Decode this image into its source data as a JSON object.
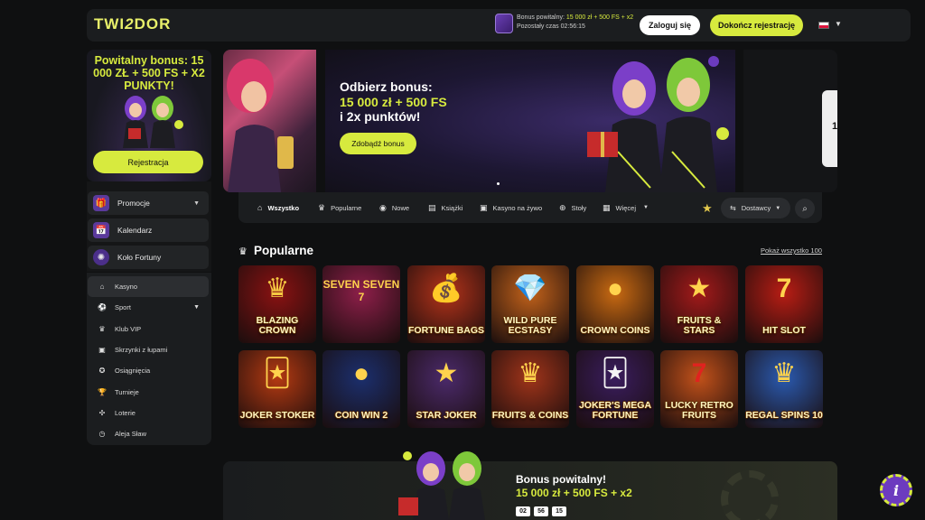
{
  "header": {
    "logo_left": "TWI",
    "logo_mid": "2",
    "logo_right": "DOR",
    "promo_line1_prefix": "Bonus powitalny: ",
    "promo_line1_highlight": "15 000 zł + 500 FS + x2",
    "promo_line2": "Pozostały czas 02:56:15",
    "login_label": "Zaloguj się",
    "register_label": "Dokończ rejestrację",
    "language_flag": "PL"
  },
  "sidebar": {
    "promo_title": "Powitalny bonus: 15 000 ZŁ + 500 FS + X2 PUNKTY!",
    "promo_button": "Rejestracja",
    "cards": [
      {
        "label": "Promocje",
        "icon": "gift-icon",
        "has_chevron": true
      },
      {
        "label": "Kalendarz",
        "icon": "calendar-icon",
        "has_chevron": false
      },
      {
        "label": "Koło Fortuny",
        "icon": "wheel-icon",
        "has_chevron": false
      }
    ],
    "menu": [
      {
        "label": "Kasyno",
        "icon": "home-icon",
        "active": true
      },
      {
        "label": "Sport",
        "icon": "sport-icon",
        "chevron": true
      },
      {
        "label": "Klub VIP",
        "icon": "vip-icon"
      },
      {
        "label": "Skrzynki z łupami",
        "icon": "box-icon"
      },
      {
        "label": "Osiągnięcia",
        "icon": "medal-icon"
      },
      {
        "label": "Turnieje",
        "icon": "trophy-icon"
      },
      {
        "label": "Loterie",
        "icon": "lottery-icon"
      },
      {
        "label": "Aleja Sław",
        "icon": "history-icon"
      }
    ]
  },
  "hero": {
    "title_line1": "Odbierz bonus:",
    "title_line2": "15 000 zł + 500 FS",
    "title_line3": "i 2x punktów!",
    "button": "Zdobądź bonus",
    "right_peek_number": "1"
  },
  "tabs": [
    {
      "label": "Wszystko",
      "icon": "home-icon",
      "active": true
    },
    {
      "label": "Popularne",
      "icon": "crown-icon"
    },
    {
      "label": "Nowe",
      "icon": "new-icon"
    },
    {
      "label": "Książki",
      "icon": "book-icon"
    },
    {
      "label": "Kasyno na żywo",
      "icon": "live-icon"
    },
    {
      "label": "Stoły",
      "icon": "table-icon"
    },
    {
      "label": "Więcej",
      "icon": "more-icon",
      "chevron": true
    }
  ],
  "providers_label": "Dostawcy",
  "section": {
    "title": "Popularne",
    "show_all": "Pokaż wszystko 100"
  },
  "games": [
    {
      "title": "BLAZING CROWN",
      "bg": "#8a1212",
      "sym": "♛",
      "symColor": "#f5c842"
    },
    {
      "title": "",
      "bg": "#8e1f4a",
      "sym": "SEVEN SEVEN 7",
      "symColor": "#ffd34d"
    },
    {
      "title": "FORTUNE BAGS",
      "bg": "#b4331a",
      "sym": "💰",
      "symColor": "#f5c842"
    },
    {
      "title": "WILD PURE ECSTASY",
      "bg": "#c2621a",
      "sym": "💎",
      "symColor": "#7fd9ff"
    },
    {
      "title": "CROWN COINS",
      "bg": "#c96a12",
      "sym": "●",
      "symColor": "#ffd34d"
    },
    {
      "title": "FRUITS & STARS",
      "bg": "#a31a1a",
      "sym": "★",
      "symColor": "#ffd34d"
    },
    {
      "title": "HIT SLOT",
      "bg": "#b81d14",
      "sym": "7",
      "symColor": "#ffd34d"
    },
    {
      "title": "JOKER STOKER",
      "bg": "#b53a12",
      "sym": "🃏",
      "symColor": "#ffd34d"
    },
    {
      "title": "COIN WIN 2",
      "bg": "#1b2f6e",
      "sym": "●",
      "symColor": "#ffd34d"
    },
    {
      "title": "STAR JOKER",
      "bg": "#4b2a6b",
      "sym": "★",
      "symColor": "#ffd34d"
    },
    {
      "title": "FRUITS & COINS",
      "bg": "#a0341a",
      "sym": "♛",
      "symColor": "#ffd34d"
    },
    {
      "title": "JOKER'S MEGA FORTUNE",
      "bg": "#3a1d5e",
      "sym": "🃏",
      "symColor": "#f4f4f4"
    },
    {
      "title": "LUCKY RETRO FRUITS",
      "bg": "#c2511a",
      "sym": "7",
      "symColor": "#e0231f"
    },
    {
      "title": "REGAL SPINS 10",
      "bg": "#2a5ab0",
      "sym": "♛",
      "symColor": "#ffd34d"
    }
  ],
  "bottom_banner": {
    "title": "Bonus powitalny!",
    "subtitle": "15 000 zł + 500 FS + x2",
    "timer": [
      "02",
      "56",
      "15"
    ]
  },
  "colors": {
    "accent": "#d7ea3e",
    "background": "#0f1011",
    "panel": "#1b1d1f"
  }
}
